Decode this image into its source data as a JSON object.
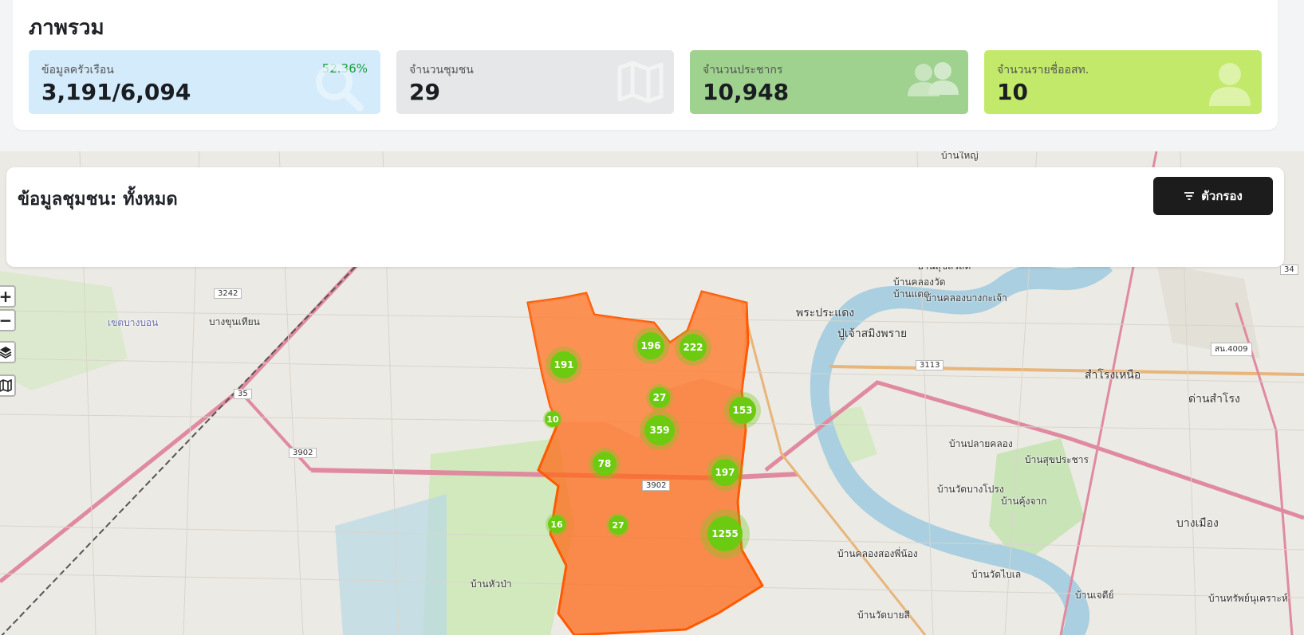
{
  "overview": {
    "title": "ภาพรวม",
    "stats": [
      {
        "label": "ข้อมูลครัวเรือน",
        "value": "3,191/6,094",
        "percent": "52.36%",
        "icon": "search-icon",
        "color": "#d3ebfa"
      },
      {
        "label": "จำนวนชุมชน",
        "value": "29",
        "icon": "map-icon",
        "color": "#e5e7e8"
      },
      {
        "label": "จำนวนประชากร",
        "value": "10,948",
        "icon": "users-icon",
        "color": "#9fd18f"
      },
      {
        "label": "จำนวนรายชื่ออสท.",
        "value": "10",
        "icon": "user-icon",
        "color": "#c3e96b"
      }
    ]
  },
  "community": {
    "title": "ข้อมูลชุมชน: ทั้งหมด",
    "filter_label": "ตัวกรอง"
  },
  "map": {
    "controls": {
      "zoom_in": "+",
      "zoom_out": "−"
    },
    "clusters": [
      "191",
      "196",
      "222",
      "27",
      "153",
      "10",
      "359",
      "78",
      "197",
      "16",
      "27",
      "1255"
    ],
    "labels": [
      "บางขุนเทียน",
      "พระประแดง",
      "ปู่เจ้าสมิงพราย",
      "สำโรงเหนือ",
      "ด่านสำโรง",
      "บางเมือง",
      "บ้านสุขสวัสดิ์",
      "บ้านคลองวัด",
      "บ้านแตด",
      "บ้านคลองบางกะเจ้า",
      "บ้านปลายคลอง",
      "บ้านสุขประชาร",
      "บ้านวัดบางโปรง",
      "บ้านคุ้งจาก",
      "บ้านใหญ่",
      "เขตบางบอน",
      "บ้านหัวป่า",
      "บ้านวัดไบเล",
      "บ้านคลองสองพี่น้อง",
      "บ้านวัดบายสี",
      "บ้านเจดีย์",
      "บ้านทรัพย์นุเคราะห์"
    ],
    "road_tags": [
      "3242",
      "35",
      "3902",
      "3113",
      "สน.4009",
      "34",
      "3902"
    ],
    "colors": {
      "polygon": "#ff6a1a",
      "cluster": "#6ccb10"
    }
  }
}
